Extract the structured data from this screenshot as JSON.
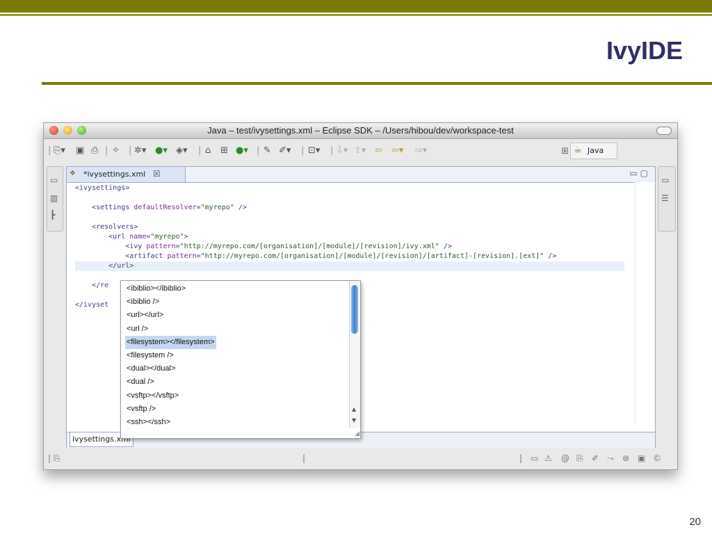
{
  "slide": {
    "title": "IvyIDE",
    "page_number": "20"
  },
  "window": {
    "title": "Java – test/ivysettings.xml – Eclipse SDK – /Users/hibou/dev/workspace-test"
  },
  "toolbar": {
    "perspective_label": "Java"
  },
  "editor": {
    "tab_label": "*ivysettings.xml",
    "tab_close": "☒",
    "bottom_tab": "ivysettings.xml",
    "code_lines": [
      [
        {
          "c": "tag",
          "t": "<ivysettings>"
        }
      ],
      [],
      [
        {
          "c": "tag",
          "t": "    <settings "
        },
        {
          "c": "attr",
          "t": "defaultResolver"
        },
        {
          "c": "tag",
          "t": "="
        },
        {
          "c": "val",
          "t": "\"myrepo\""
        },
        {
          "c": "tag",
          "t": " />"
        }
      ],
      [],
      [
        {
          "c": "tag",
          "t": "    <resolvers>"
        }
      ],
      [
        {
          "c": "tag",
          "t": "        <url "
        },
        {
          "c": "attr",
          "t": "name"
        },
        {
          "c": "tag",
          "t": "="
        },
        {
          "c": "val",
          "t": "\"myrepo\""
        },
        {
          "c": "tag",
          "t": ">"
        }
      ],
      [
        {
          "c": "tag",
          "t": "            <ivy "
        },
        {
          "c": "attr",
          "t": "pattern"
        },
        {
          "c": "tag",
          "t": "="
        },
        {
          "c": "val",
          "t": "\"http://myrepo.com/[organisation]/[module]/[revision]/ivy.xml\""
        },
        {
          "c": "tag",
          "t": " />"
        }
      ],
      [
        {
          "c": "tag",
          "t": "            <artifact "
        },
        {
          "c": "attr",
          "t": "pattern"
        },
        {
          "c": "tag",
          "t": "="
        },
        {
          "c": "val",
          "t": "\"http://myrepo.com/[organisation]/[module]/[revision]/[artifact]-[revision].[ext]\""
        },
        {
          "c": "tag",
          "t": " />"
        }
      ],
      [
        {
          "c": "tag",
          "t": "        </url>"
        }
      ],
      [],
      [
        {
          "c": "tag",
          "t": "    </re"
        }
      ],
      [],
      [
        {
          "c": "tag",
          "t": "</ivyset"
        }
      ]
    ]
  },
  "popup": {
    "items": [
      "<ibiblio></ibiblio>",
      "<ibiblio />",
      "<url></url>",
      "<url />",
      "<filesystem></filesystem>",
      "<filesystem />",
      "<dual></dual>",
      "<dual />",
      "<vsftp></vsftp>",
      "<vsftp />",
      "<ssh></ssh>"
    ],
    "selected_index": 4
  },
  "colors": {
    "accent": "#7a7a00",
    "title": "#2e2e6a",
    "selection": "#c5d7f0"
  }
}
